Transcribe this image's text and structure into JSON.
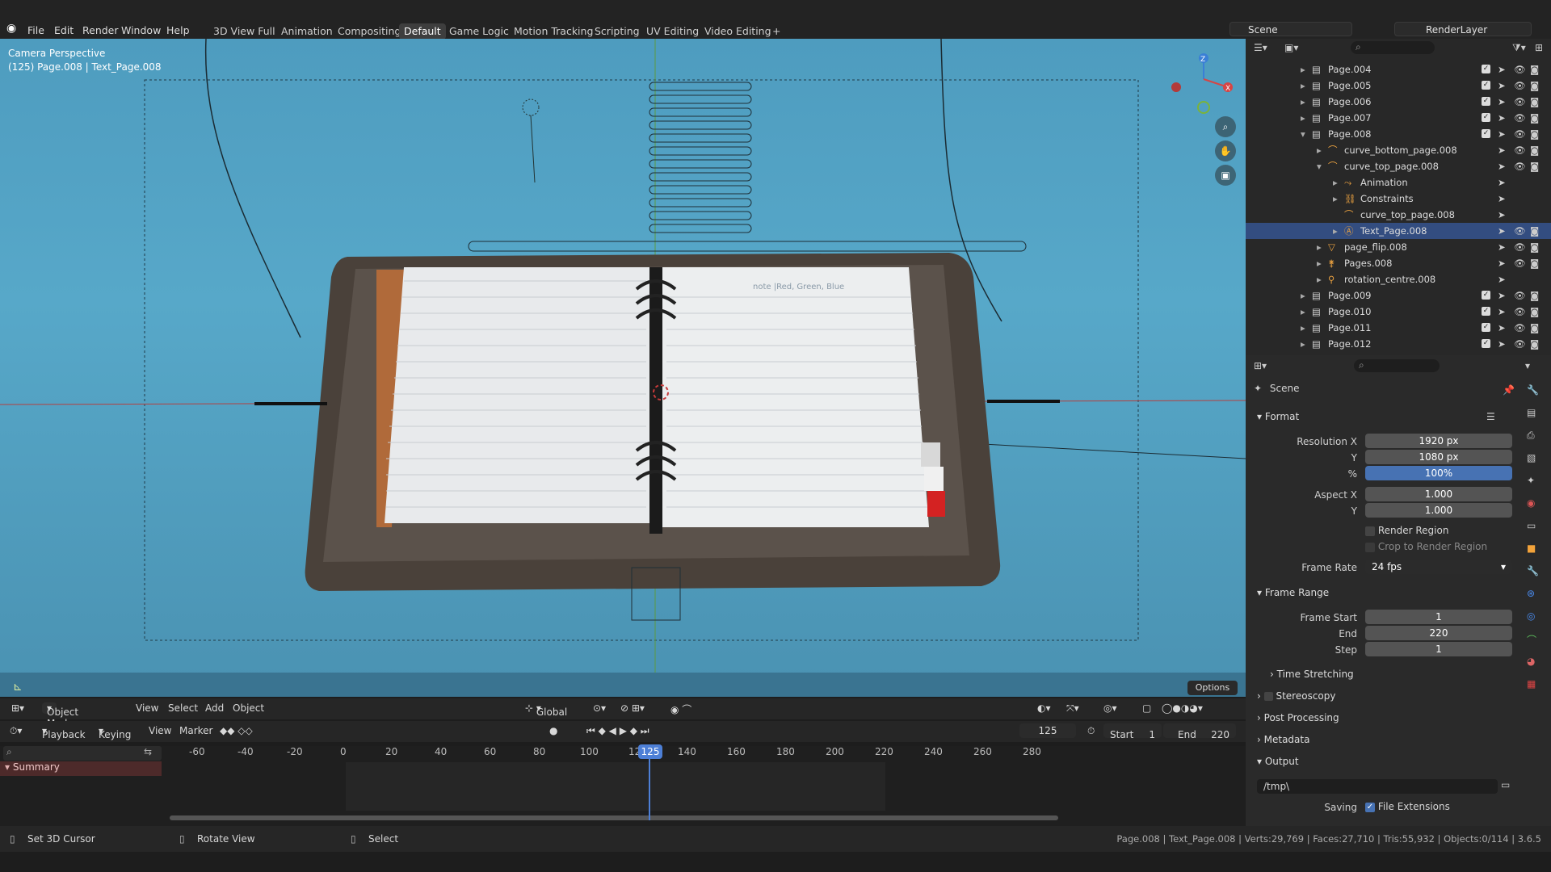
{
  "menus": [
    "File",
    "Edit",
    "Render",
    "Window",
    "Help"
  ],
  "workspaces": [
    "3D View Full",
    "Animation",
    "Compositing",
    "Default",
    "Game Logic",
    "Motion Tracking",
    "Scripting",
    "UV Editing",
    "Video Editing",
    "+"
  ],
  "scene": {
    "name": "Scene",
    "layer": "RenderLayer"
  },
  "viewport": {
    "title": "Camera Perspective",
    "subtitle": "(125) Page.008 | Text_Page.008",
    "options": "Options",
    "note_text": "note |Red, Green, Blue"
  },
  "header": {
    "mode": "Object Mode",
    "view": "View",
    "select": "Select",
    "add": "Add",
    "object": "Object",
    "orientation": "Global"
  },
  "timeline": {
    "playback": "Playback",
    "keying": "Keying",
    "view": "View",
    "marker": "Marker",
    "current": "125",
    "start_label": "Start",
    "start": "1",
    "end_label": "End",
    "end": "220",
    "ticks": [
      "-60",
      "-40",
      "-20",
      "0",
      "20",
      "40",
      "60",
      "80",
      "100",
      "12",
      "140",
      "160",
      "180",
      "200",
      "220",
      "240",
      "260",
      "280"
    ],
    "current_badge": "125",
    "summary": "Summary"
  },
  "outliner": {
    "rows": [
      {
        "name": "Page.004"
      },
      {
        "name": "Page.005"
      },
      {
        "name": "Page.006"
      },
      {
        "name": "Page.007"
      },
      {
        "name": "Page.008"
      },
      {
        "name": "curve_bottom_page.008"
      },
      {
        "name": "curve_top_page.008"
      },
      {
        "name": "Animation"
      },
      {
        "name": "Constraints"
      },
      {
        "name": "curve_top_page.008"
      },
      {
        "name": "Text_Page.008"
      },
      {
        "name": "page_flip.008"
      },
      {
        "name": "Pages.008"
      },
      {
        "name": "rotation_centre.008"
      },
      {
        "name": "Page.009"
      },
      {
        "name": "Page.010"
      },
      {
        "name": "Page.011"
      },
      {
        "name": "Page.012"
      }
    ]
  },
  "properties": {
    "context": "Scene",
    "format": {
      "title": "Format",
      "res_x_label": "Resolution X",
      "res_x": "1920 px",
      "res_y_label": "Y",
      "res_y": "1080 px",
      "pct_label": "%",
      "pct": "100%",
      "aspect_x_label": "Aspect X",
      "aspect_x": "1.000",
      "aspect_y_label": "Y",
      "aspect_y": "1.000",
      "render_region": "Render Region",
      "crop": "Crop to Render Region",
      "fps_label": "Frame Rate",
      "fps": "24 fps"
    },
    "frame_range": {
      "title": "Frame Range",
      "start_label": "Frame Start",
      "start": "1",
      "end_label": "End",
      "end": "220",
      "step_label": "Step",
      "step": "1",
      "time_stretch": "Time Stretching"
    },
    "panels": [
      "Stereoscopy",
      "Post Processing",
      "Metadata"
    ],
    "output": {
      "title": "Output",
      "path": "/tmp\\",
      "saving_label": "Saving",
      "file_ext": "File Extensions"
    }
  },
  "status": {
    "left1": "Set 3D Cursor",
    "left2": "Rotate View",
    "left3": "Select",
    "right": "Page.008 | Text_Page.008 | Verts:29,769 | Faces:27,710 | Tris:55,932 | Objects:0/114 | 3.6.5"
  }
}
